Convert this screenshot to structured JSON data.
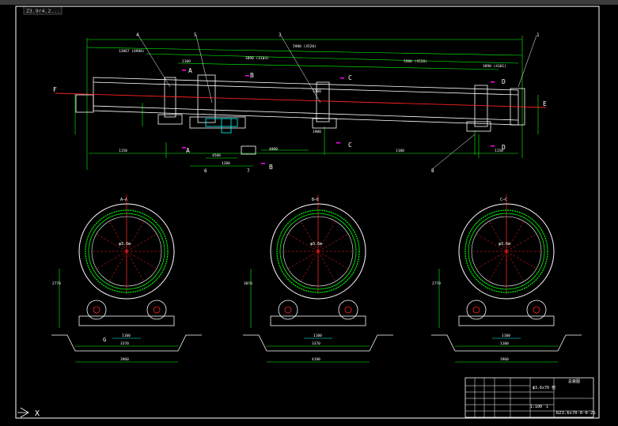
{
  "window": {
    "tab_label": "Z3.9r4.2...",
    "ucs_x_label": "X"
  },
  "colors": {
    "background": "#000000",
    "frame": "#ffffff",
    "outline": "#ffffff",
    "center_line": "#ff2020",
    "dimension": "#00ff00",
    "leader": "#00ffff",
    "section_marker": "#ff00ff",
    "accent_yellow": "#ffff00"
  },
  "icons": {
    "ucs": "ucs-axis-icon"
  },
  "elevation": {
    "section_letters": {
      "top": [
        "A",
        "B",
        "C",
        "D"
      ],
      "bottom": [
        "A",
        "B",
        "C",
        "D"
      ],
      "ends": [
        "F",
        "E"
      ]
    },
    "part_numbers": [
      "4",
      "5",
      "3",
      "1",
      "6",
      "7",
      "8"
    ],
    "dimension_texts": [
      "13867 (6980)",
      "3890 (4104)",
      "5980 (4520)",
      "5980 (4520)",
      "3890 (4101)",
      "2100",
      "1150",
      "4080",
      "1100",
      "1900",
      "1200",
      "4580",
      "1150",
      "3100"
    ]
  },
  "sections": [
    {
      "id": "A-A",
      "title": "A—A",
      "dimensions": {
        "height_left": "2770",
        "width_mid": "3370",
        "width_overall": "3960",
        "bottom_span": "1100"
      },
      "labels": [
        "φ3.6m"
      ],
      "marker": "G"
    },
    {
      "id": "B-B",
      "title": "B—B",
      "dimensions": {
        "height_left": "3070",
        "width_mid": "3370",
        "width_overall": "4190",
        "bottom_span": "1100"
      },
      "labels": [
        "φ3.6m"
      ],
      "marker": ""
    },
    {
      "id": "C-C",
      "title": "C—C",
      "dimensions": {
        "height_left": "2770",
        "width_mid": "1100",
        "width_overall": "3960",
        "bottom_span": "1100"
      },
      "labels": [
        "φ3.6m"
      ],
      "marker": ""
    }
  ],
  "title_block": {
    "project_label": "ϕ3.6x70 窑",
    "sheet_label": "总装图",
    "drawing_no": "RZ3.6x70-0-0-2S",
    "scale": "1:100",
    "sheet": "1"
  }
}
